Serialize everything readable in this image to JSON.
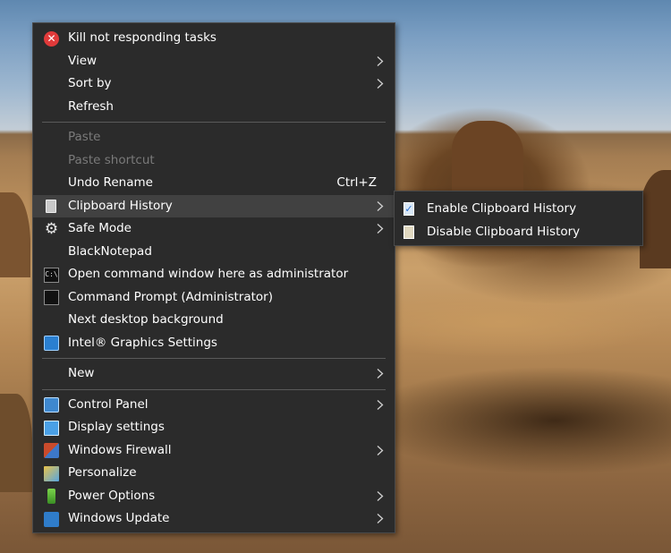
{
  "context_menu": {
    "items": [
      {
        "label": "Kill not responding tasks"
      },
      {
        "label": "View"
      },
      {
        "label": "Sort by"
      },
      {
        "label": "Refresh"
      },
      {
        "label": "Paste"
      },
      {
        "label": "Paste shortcut"
      },
      {
        "label": "Undo Rename",
        "shortcut": "Ctrl+Z"
      },
      {
        "label": "Clipboard History"
      },
      {
        "label": "Safe Mode"
      },
      {
        "label": "BlackNotepad"
      },
      {
        "label": "Open command window here as administrator"
      },
      {
        "label": "Command Prompt (Administrator)"
      },
      {
        "label": "Next desktop background"
      },
      {
        "label": "Intel® Graphics Settings"
      },
      {
        "label": "New"
      },
      {
        "label": "Control Panel"
      },
      {
        "label": "Display settings"
      },
      {
        "label": "Windows Firewall"
      },
      {
        "label": "Personalize"
      },
      {
        "label": "Power Options"
      },
      {
        "label": "Windows Update"
      }
    ]
  },
  "clipboard_submenu": {
    "items": [
      {
        "label": "Enable Clipboard History"
      },
      {
        "label": "Disable Clipboard History"
      }
    ]
  },
  "icons": {
    "kill_glyph": "✕",
    "gear_glyph": "⚙",
    "cmd_glyph": "C:\\",
    "check_glyph": "✓"
  },
  "colors": {
    "menu_background": "#2b2b2b",
    "menu_highlight": "#414141",
    "disabled_text": "#7a7a7a",
    "kill_icon": "#e03a3a"
  }
}
